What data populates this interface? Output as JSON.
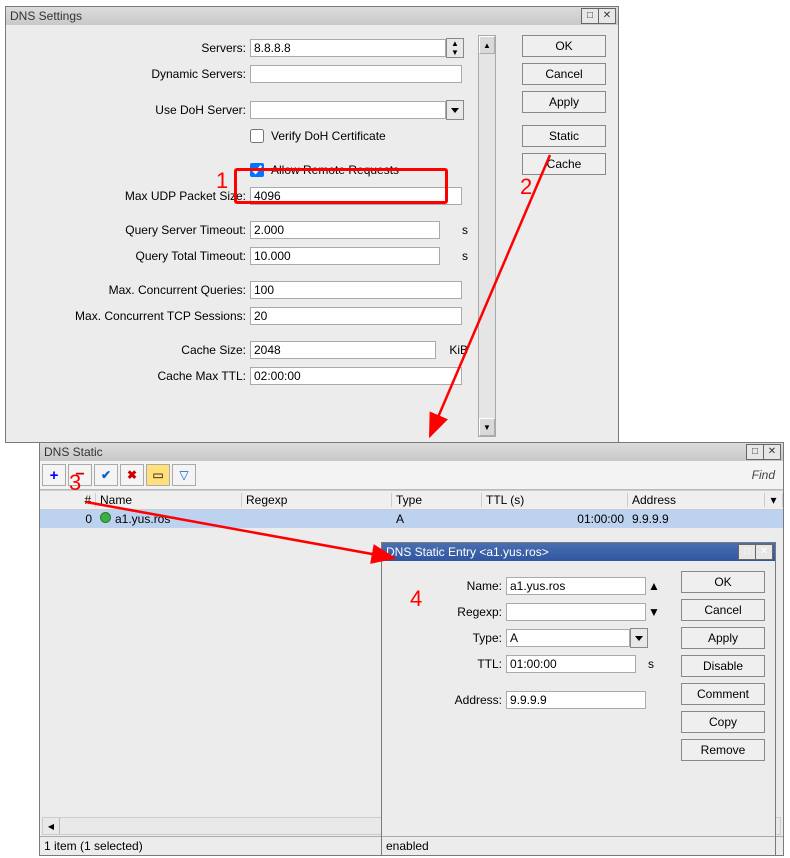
{
  "window_dns": {
    "title": "DNS Settings",
    "labels": {
      "servers": "Servers:",
      "dyn_servers": "Dynamic Servers:",
      "use_doh": "Use DoH Server:",
      "verify_doh": "Verify DoH Certificate",
      "allow_remote": "Allow Remote Requests",
      "max_udp": "Max UDP Packet Size:",
      "q_server_to": "Query Server Timeout:",
      "q_total_to": "Query Total Timeout:",
      "max_conc_q": "Max. Concurrent Queries:",
      "max_conc_tcp": "Max. Concurrent TCP Sessions:",
      "cache_size": "Cache Size:",
      "cache_max_ttl": "Cache Max TTL:"
    },
    "values": {
      "servers": "8.8.8.8",
      "dyn_servers": "",
      "use_doh": "",
      "verify_doh": false,
      "allow_remote": true,
      "max_udp": "4096",
      "q_server_to": "2.000",
      "q_total_to": "10.000",
      "max_conc_q": "100",
      "max_conc_tcp": "20",
      "cache_size": "2048",
      "cache_max_ttl": "02:00:00"
    },
    "units": {
      "seconds": "s",
      "kib": "KiB"
    },
    "buttons": {
      "ok": "OK",
      "cancel": "Cancel",
      "apply": "Apply",
      "static": "Static",
      "cache": "Cache"
    }
  },
  "window_static": {
    "title": "DNS Static",
    "find": "Find",
    "toolbar": [
      "plus-icon",
      "minus-icon",
      "check-icon",
      "cross-icon",
      "note-icon",
      "filter-icon"
    ],
    "columns": {
      "num": "#",
      "name": "Name",
      "regexp": "Regexp",
      "type": "Type",
      "ttl": "TTL (s)",
      "address": "Address"
    },
    "rows": [
      {
        "num": "0",
        "name": "a1.yus.ros",
        "regexp": "",
        "type": "A",
        "ttl": "01:00:00",
        "address": "9.9.9.9"
      }
    ],
    "status": "1 item (1 selected)"
  },
  "window_entry": {
    "title": "DNS Static Entry <a1.yus.ros>",
    "labels": {
      "name": "Name:",
      "regexp": "Regexp:",
      "type": "Type:",
      "ttl": "TTL:",
      "address": "Address:"
    },
    "values": {
      "name": "a1.yus.ros",
      "regexp": "",
      "type": "A",
      "ttl": "01:00:00",
      "address": "9.9.9.9"
    },
    "units": {
      "seconds": "s"
    },
    "buttons": {
      "ok": "OK",
      "cancel": "Cancel",
      "apply": "Apply",
      "disable": "Disable",
      "comment": "Comment",
      "copy": "Copy",
      "remove": "Remove"
    },
    "status": "enabled"
  },
  "annotations": {
    "a1": "1",
    "a2": "2",
    "a3": "3",
    "a4": "4"
  }
}
